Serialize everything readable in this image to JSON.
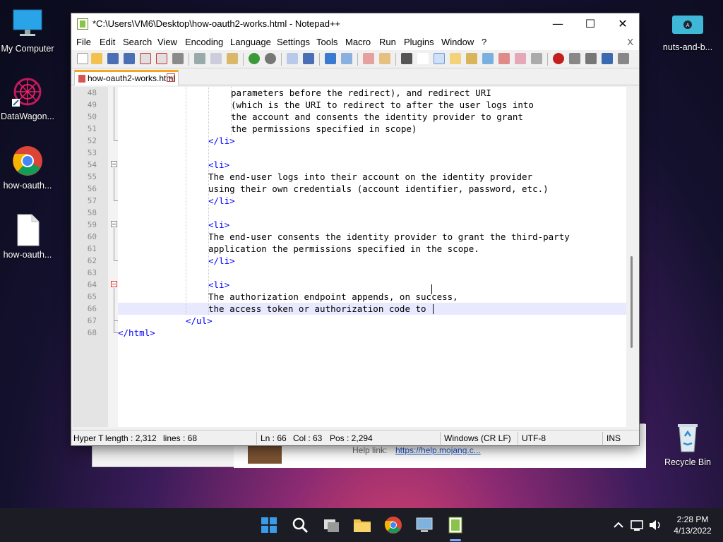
{
  "desktop": {
    "icons": [
      {
        "label": "My Computer"
      },
      {
        "label": "DataWagon..."
      },
      {
        "label": "how-oauth..."
      },
      {
        "label": "how-oauth..."
      },
      {
        "label": "nuts-and-b..."
      },
      {
        "label": "Recycle Bin"
      }
    ]
  },
  "background_window": {
    "help_label": "Help link:",
    "help_link": "https://help.mojang.c..."
  },
  "window": {
    "title": "*C:\\Users\\VM6\\Desktop\\how-oauth2-works.html - Notepad++",
    "minimize": "—",
    "maximize": "☐",
    "close": "✕"
  },
  "menu": {
    "items": [
      "File",
      "Edit",
      "Search",
      "View",
      "Encoding",
      "Language",
      "Settings",
      "Tools",
      "Macro",
      "Run",
      "Plugins",
      "Window",
      "?"
    ],
    "close_doc": "X"
  },
  "tab": {
    "name": "how-oauth2-works.html",
    "close": "x"
  },
  "editor": {
    "lines": [
      {
        "num": "48",
        "text": "        parameters before the redirect), and redirect URI"
      },
      {
        "num": "49",
        "text": "        (which is the URI to redirect to after the user logs into"
      },
      {
        "num": "50",
        "text": "        the account and consents the identity provider to grant"
      },
      {
        "num": "51",
        "text": "        the permissions specified in scope)"
      },
      {
        "num": "52",
        "text": "</li>"
      },
      {
        "num": "53",
        "text": ""
      },
      {
        "num": "54",
        "text": "<li>"
      },
      {
        "num": "55",
        "text": "    The end-user logs into their account on the identity provider"
      },
      {
        "num": "56",
        "text": "    using their own credentials (account identifier, password, etc.)"
      },
      {
        "num": "57",
        "text": "</li>"
      },
      {
        "num": "58",
        "text": ""
      },
      {
        "num": "59",
        "text": "<li>"
      },
      {
        "num": "60",
        "text": "    The end-user consents the identity provider to grant the third-party"
      },
      {
        "num": "61",
        "text": "    application the permissions specified in the scope."
      },
      {
        "num": "62",
        "text": "</li>"
      },
      {
        "num": "63",
        "text": ""
      },
      {
        "num": "64",
        "text": "<li>"
      },
      {
        "num": "65",
        "text": "    The authorization endpoint appends, on success,"
      },
      {
        "num": "66",
        "text": "    the access token or authorization code to "
      },
      {
        "num": "67",
        "text": "</ul>"
      },
      {
        "num": "68",
        "text": "</html>"
      }
    ]
  },
  "status": {
    "file_type": "Hyper T",
    "length": "length : 2,312",
    "lines": "lines : 68",
    "ln": "Ln : 66",
    "col": "Col : 63",
    "pos": "Pos : 2,294",
    "eol": "Windows (CR LF)",
    "encoding": "UTF-8",
    "mode": "INS"
  },
  "taskbar": {
    "time": "2:28 PM",
    "date": "4/13/2022",
    "icons": [
      "start-icon",
      "search-icon",
      "task-view-icon",
      "file-explorer-icon",
      "chrome-icon",
      "remote-desktop-icon",
      "notepadpp-icon"
    ]
  },
  "colors": {
    "tag": "#0000ff",
    "current_line": "#e8e8ff",
    "tab_accent": "#f5a623"
  }
}
